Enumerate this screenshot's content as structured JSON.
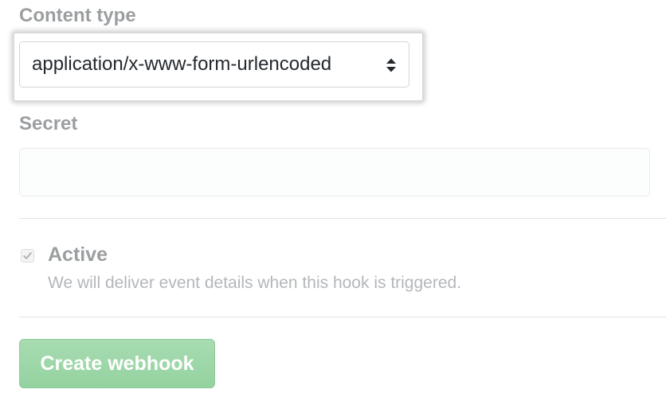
{
  "content_type": {
    "label": "Content type",
    "selected_value": "application/x-www-form-urlencoded",
    "icon": "select-arrows-icon"
  },
  "secret": {
    "label": "Secret",
    "value": ""
  },
  "active": {
    "label": "Active",
    "description": "We will deliver event details when this hook is triggered.",
    "checked": true
  },
  "submit": {
    "label": "Create webhook"
  },
  "colors": {
    "button_bg": "#94d2a0",
    "text": "#24292e"
  }
}
